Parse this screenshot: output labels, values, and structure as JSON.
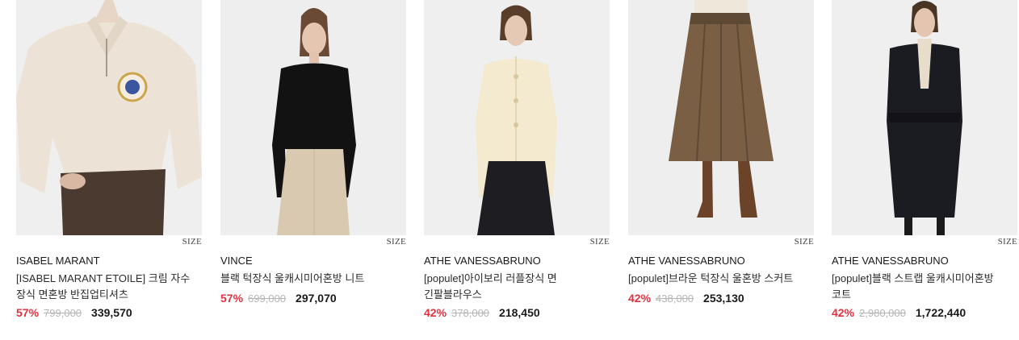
{
  "size_label": "SIZE",
  "colors": {
    "discount": "#e03140",
    "original_price": "#b5b5b5",
    "sale_price": "#1a1a1a"
  },
  "products": [
    {
      "brand": "ISABEL MARANT",
      "name": "[ISABEL MARANT ETOILE] 크림 자수 장식 면혼방 반집업티셔츠",
      "discount": "57%",
      "original_price": "799,000",
      "sale_price": "339,570",
      "image": "cream-half-zip-sweatshirt"
    },
    {
      "brand": "VINCE",
      "name": "블랙 턱장식 울캐시미어혼방 니트",
      "discount": "57%",
      "original_price": "699,000",
      "sale_price": "297,070",
      "image": "black-draped-knit-top"
    },
    {
      "brand": "ATHE VANESSABRUNO",
      "name": "[populet]아이보리 러플장식 면 긴팔블라우스",
      "discount": "42%",
      "original_price": "378,000",
      "sale_price": "218,450",
      "image": "ivory-ruffle-blouse"
    },
    {
      "brand": "ATHE VANESSABRUNO",
      "name": "[populet]브라운 턱장식 울혼방 스커트",
      "discount": "42%",
      "original_price": "438,000",
      "sale_price": "253,130",
      "image": "brown-pleated-skirt"
    },
    {
      "brand": "ATHE VANESSABRUNO",
      "name": "[populet]블랙 스트랩 울캐시미어혼방 코트",
      "discount": "42%",
      "original_price": "2,980,000",
      "sale_price": "1,722,440",
      "image": "black-belted-coat"
    }
  ]
}
